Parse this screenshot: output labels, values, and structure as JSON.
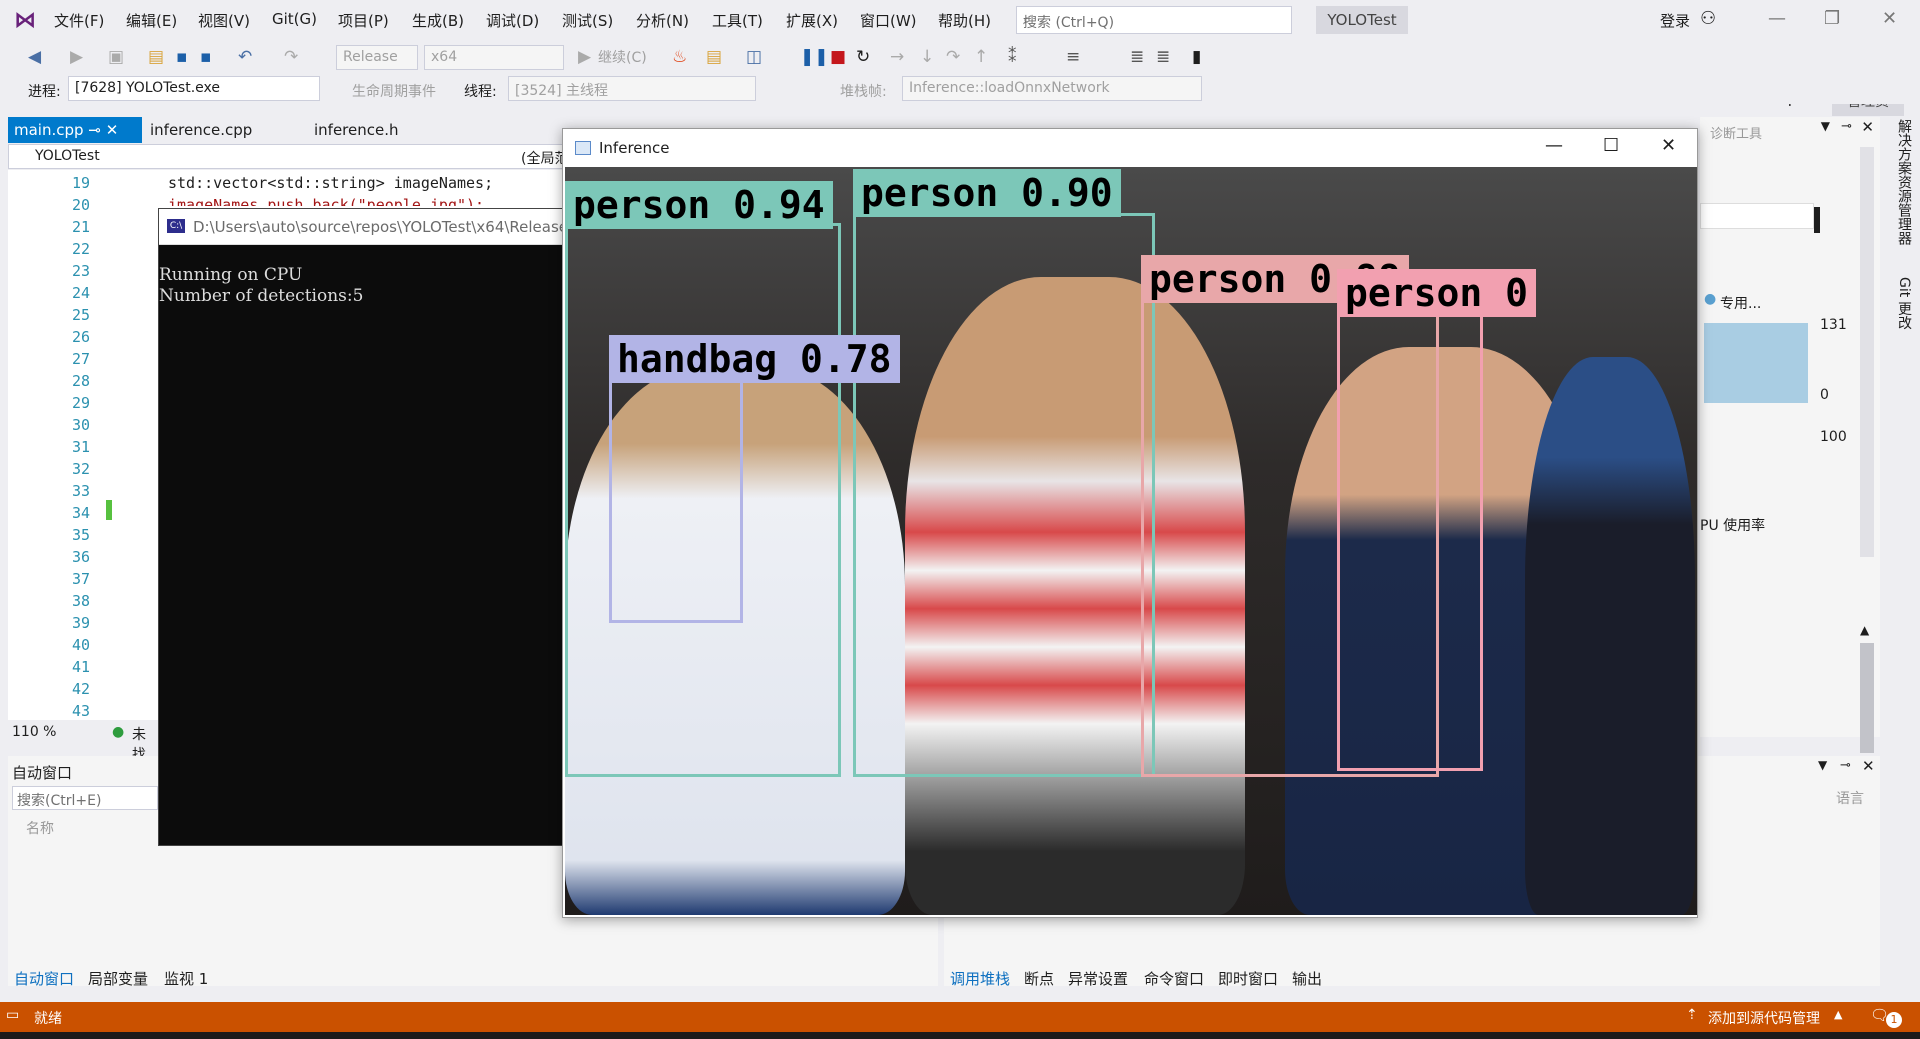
{
  "menubar": {
    "items": [
      "文件(F)",
      "编辑(E)",
      "视图(V)",
      "Git(G)",
      "项目(P)",
      "生成(B)",
      "调试(D)",
      "测试(S)",
      "分析(N)",
      "工具(T)",
      "扩展(X)",
      "窗口(W)",
      "帮助(H)"
    ],
    "search_placeholder": "搜索 (Ctrl+Q)",
    "solution_name": "YOLOTest",
    "login": "登录"
  },
  "toolbar": {
    "config": "Release",
    "platform": "x64",
    "continue": "继续(C)",
    "live_share": "Live Share",
    "admin": "管理员"
  },
  "procbar": {
    "process_label": "进程:",
    "process_value": "[7628] YOLOTest.exe",
    "lifecycle": "生命周期事件",
    "thread_label": "线程:",
    "thread_value": "[3524] 主线程",
    "stack_label": "堆栈帧:",
    "stack_value": "Inference::loadOnnxNetwork"
  },
  "editor": {
    "tabs": [
      "main.cpp",
      "inference.cpp",
      "inference.h"
    ],
    "project": "YOLOTest",
    "scope": "(全局范",
    "line_numbers": [
      "19",
      "20",
      "21",
      "22",
      "23",
      "24",
      "25",
      "26",
      "27",
      "28",
      "29",
      "30",
      "31",
      "32",
      "33",
      "34",
      "35",
      "36",
      "37",
      "38",
      "39",
      "40",
      "41",
      "42",
      "43"
    ],
    "code_line_19": "std::vector<std::string> imageNames;",
    "code_line_20": "imageNames.push_back(\"people.jpg\");",
    "zoom": "110 %",
    "status": "未找"
  },
  "console": {
    "title": "D:\\Users\\auto\\source\\repos\\YOLOTest\\x64\\Release",
    "line1": "Running on CPU",
    "line2": "Number of detections:5"
  },
  "inference": {
    "title": "Inference",
    "detections": [
      {
        "label": "person 0.94",
        "color": "#7cc7b8"
      },
      {
        "label": "person 0.90",
        "color": "#7cc7b8"
      },
      {
        "label": "handbag 0.78",
        "color": "#b2b4e6"
      },
      {
        "label": "person 0.88",
        "color": "#e8a7a9"
      },
      {
        "label": "person 0",
        "color": "#f2a0b0"
      }
    ]
  },
  "diagnostics": {
    "title": "诊断工具",
    "legend": "专用...",
    "val_131": "131",
    "val_0": "0",
    "val_100": "100",
    "cpu": "PU 使用率",
    "lang": "语言"
  },
  "right_tabs": [
    "解决方案资源管理器",
    "Git 更改"
  ],
  "autos": {
    "title": "自动窗口",
    "search": "搜索(Ctrl+E)",
    "col_name": "名称",
    "tabs": [
      "自动窗口",
      "局部变量",
      "监视 1"
    ]
  },
  "callstack": {
    "tabs": [
      "调用堆栈",
      "断点",
      "异常设置",
      "命令窗口",
      "即时窗口",
      "输出"
    ]
  },
  "statusbar": {
    "ready": "就绪",
    "source_control": "添加到源代码管理",
    "notif": "1"
  }
}
